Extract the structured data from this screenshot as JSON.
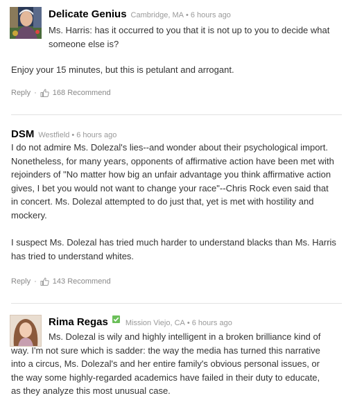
{
  "comments": [
    {
      "author": "Delicate Genius",
      "location": "Cambridge, MA",
      "time": "6 hours ago",
      "paragraphs": [
        "Ms. Harris: has it occurred to you that it is not up to you to decide what someone else is?",
        "Enjoy your 15 minutes, but this is petulant and arrogant."
      ],
      "reply_label": "Reply",
      "recommend_label": "168 Recommend"
    },
    {
      "author": "DSM",
      "location": "Westfield",
      "time": "6 hours ago",
      "paragraphs": [
        "I do not admire Ms. Dolezal's lies--and wonder about their psychological import. Nonetheless, for many years, opponents of affirmative action have been met with rejoinders of \"No matter how big an unfair advantage you think affirmative action gives, I bet you would not want to change your race\"--Chris Rock even said that in concert. Ms. Dolezal attempted to do just that, yet is met with hostility and mockery.",
        "I suspect Ms. Dolezal has tried much harder to understand blacks than Ms. Harris has tried to understand whites."
      ],
      "reply_label": "Reply",
      "recommend_label": "143 Recommend"
    },
    {
      "author": "Rima Regas",
      "location": "Mission Viejo, CA",
      "time": "6 hours ago",
      "paragraphs": [
        "Ms. Dolezal is wily and highly intelligent in a broken brilliance kind of way. I'm not sure which is sadder: the way the media has turned this narrative into a circus, Ms. Dolezal's and her entire family's obvious personal issues, or the way some highly-regarded academics have failed in their duty to educate, as they analyze this most unusual case."
      ]
    }
  ],
  "colors": {
    "verified": "#6bbf59",
    "meta": "#999999",
    "divider": "#e2e2e2"
  }
}
